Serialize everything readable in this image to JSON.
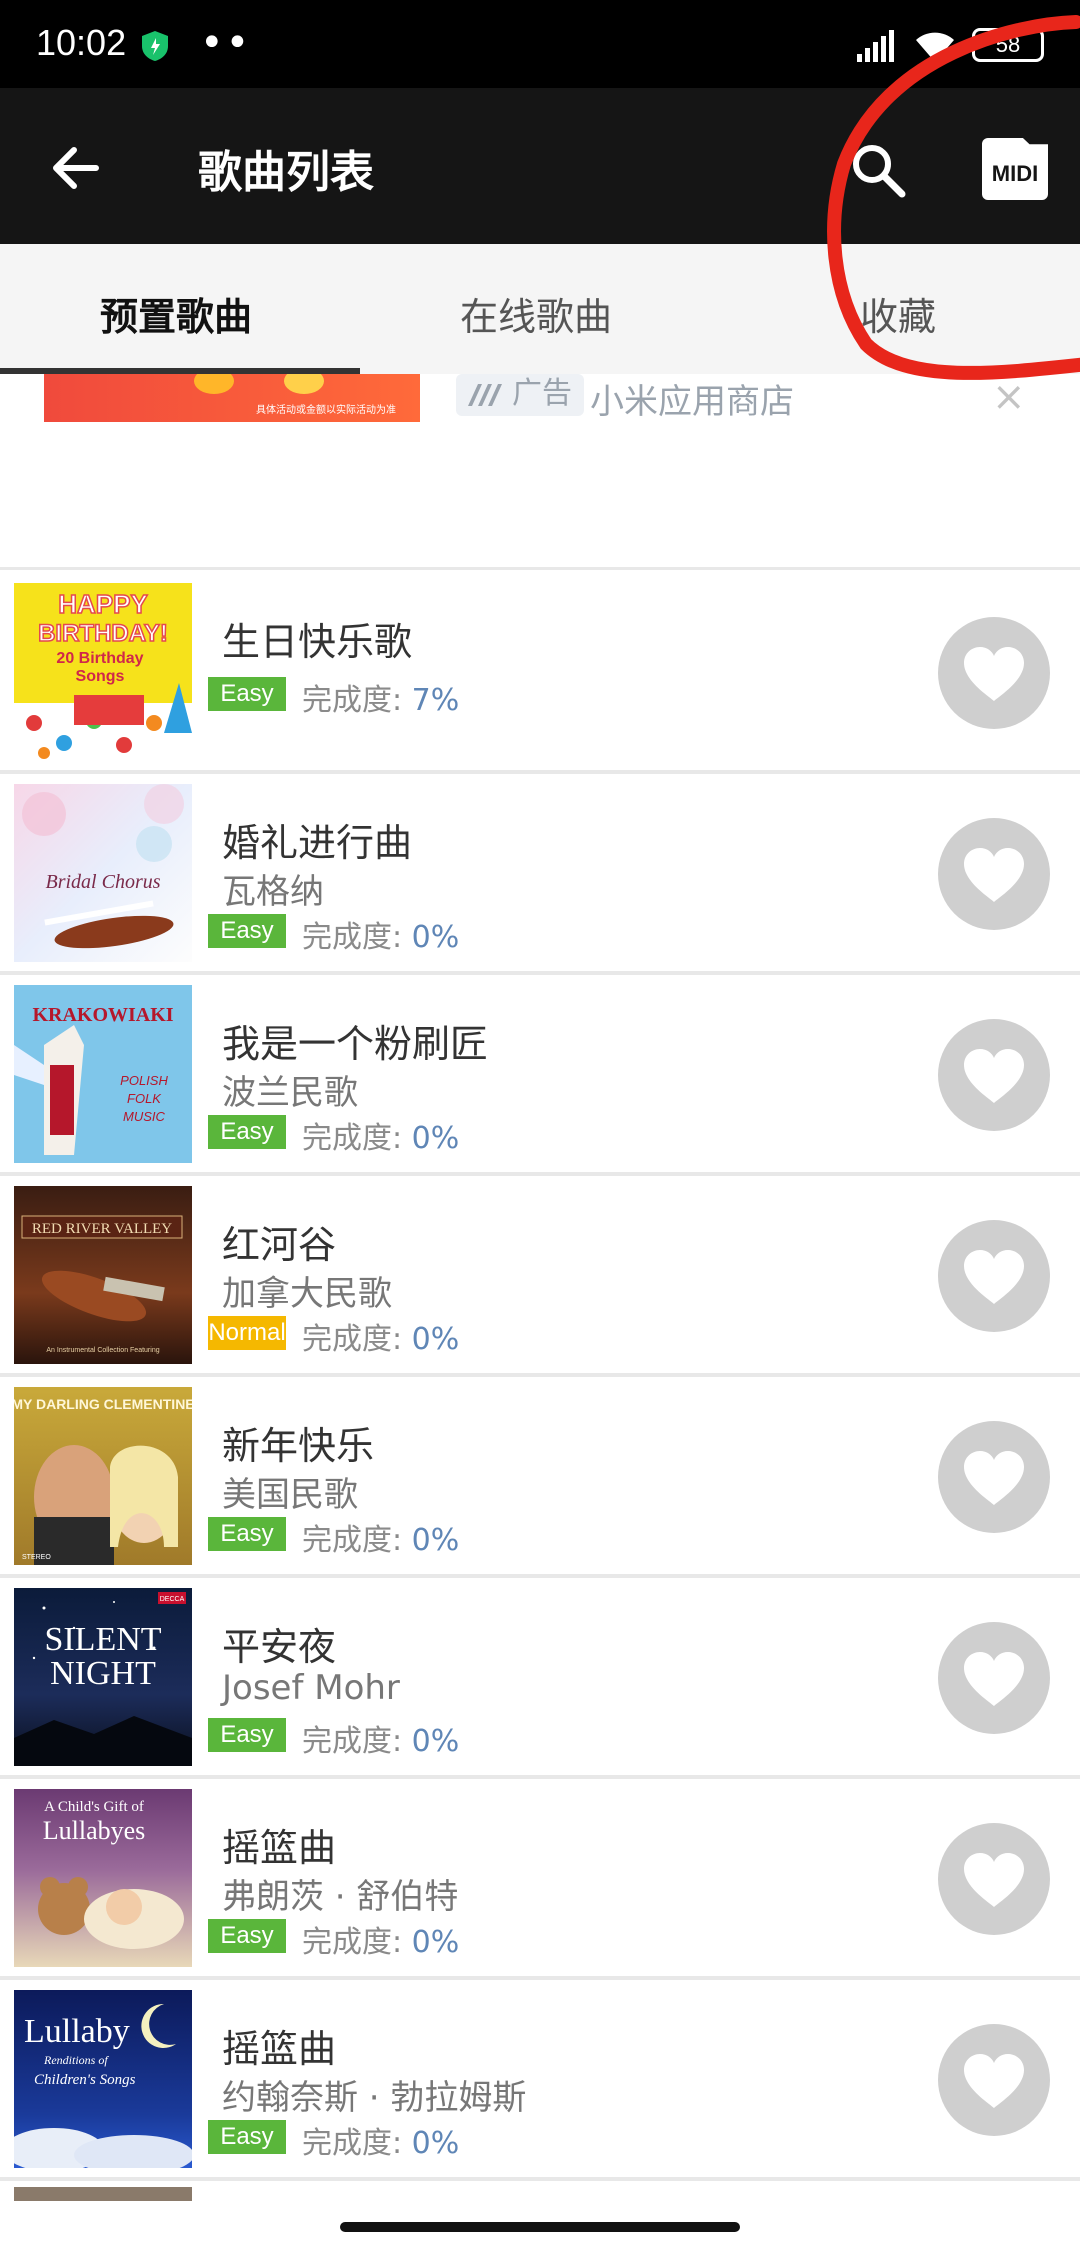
{
  "status_bar": {
    "time": "10:02",
    "battery": "58"
  },
  "app_bar": {
    "title": "歌曲列表",
    "midi_label": "MIDI"
  },
  "tabs": [
    {
      "label": "预置歌曲",
      "active": true
    },
    {
      "label": "在线歌曲",
      "active": false
    },
    {
      "label": "收藏",
      "active": false
    }
  ],
  "ad": {
    "banner_text": "具体活动或金额以实际活动为准",
    "badge_label": "广告",
    "source": "小米应用商店",
    "close": "×"
  },
  "songs": [
    {
      "title": "生日快乐歌",
      "artist": "",
      "level": "Easy",
      "progress_label": "完成度:",
      "progress": "7%",
      "cover": "happy-birthday-cover"
    },
    {
      "title": "婚礼进行曲",
      "artist": "瓦格纳",
      "level": "Easy",
      "progress_label": "完成度:",
      "progress": "0%",
      "cover": "bridal-chorus-cover"
    },
    {
      "title": "我是一个粉刷匠",
      "artist": "波兰民歌",
      "level": "Easy",
      "progress_label": "完成度:",
      "progress": "0%",
      "cover": "krakowiaki-cover"
    },
    {
      "title": "红河谷",
      "artist": "加拿大民歌",
      "level": "Normal",
      "progress_label": "完成度:",
      "progress": "0%",
      "cover": "red-river-valley-cover"
    },
    {
      "title": "新年快乐",
      "artist": "美国民歌",
      "level": "Easy",
      "progress_label": "完成度:",
      "progress": "0%",
      "cover": "my-darling-clementine-cover"
    },
    {
      "title": "平安夜",
      "artist": "Josef Mohr",
      "level": "Easy",
      "progress_label": "完成度:",
      "progress": "0%",
      "cover": "silent-night-cover"
    },
    {
      "title": "摇篮曲",
      "artist": "弗朗茨 · 舒伯特",
      "level": "Easy",
      "progress_label": "完成度:",
      "progress": "0%",
      "cover": "lullabyes-cover"
    },
    {
      "title": "摇篮曲",
      "artist": "约翰奈斯 · 勃拉姆斯",
      "level": "Easy",
      "progress_label": "完成度:",
      "progress": "0%",
      "cover": "lullaby-cover"
    }
  ],
  "covers": {
    "happy_birthday": {
      "line1": "HAPPY",
      "line2": "BIRTHDAY!",
      "line3": "20 Birthday",
      "line4": "Songs"
    },
    "bridal": {
      "text": "Bridal Chorus"
    },
    "krakowiaki": {
      "title": "KRAKOWIAKI",
      "sub1": "POLISH",
      "sub2": "FOLK",
      "sub3": "MUSIC"
    },
    "red_river": {
      "text": "RED RIVER VALLEY",
      "small": "An Instrumental Collection Featuring"
    },
    "clementine": {
      "text": "MY DARLING CLEMENTINE",
      "small": "STEREO"
    },
    "silent_night": {
      "line1": "SILENT",
      "line2": "NIGHT",
      "label": "DECCA"
    },
    "lullabyes": {
      "line1": "A Child's Gift of",
      "line2": "Lullabyes"
    },
    "lullaby": {
      "line1": "Lullaby",
      "line2": "Renditions of",
      "line3": "Children's Songs"
    }
  },
  "colors": {
    "easy": "#5ab63b",
    "normal": "#f5b800",
    "progress": "#5f86b6",
    "annotation": "#e8261b"
  }
}
